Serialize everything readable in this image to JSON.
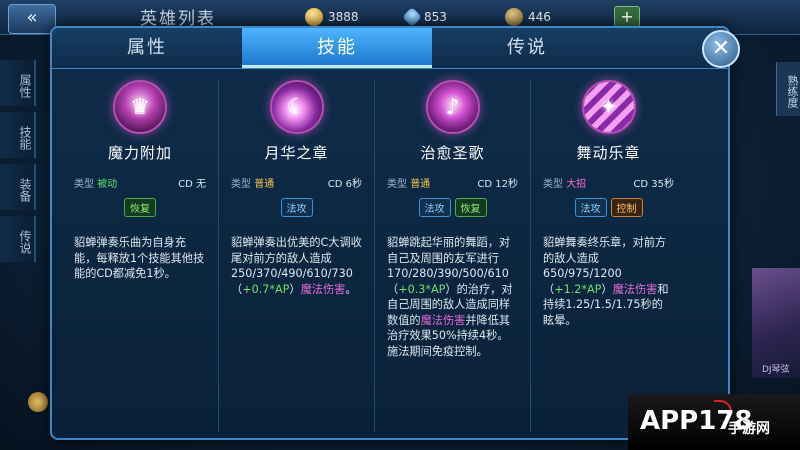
{
  "header": {
    "back_icon": "back-arrow-icon",
    "title": "英雄列表",
    "gold": "3888",
    "diamonds": "853",
    "coupons": "446",
    "plus_label": "+"
  },
  "side_tabs": [
    "属性",
    "技能",
    "装备",
    "传说"
  ],
  "right_tab": "熟练度",
  "right_art_label": "DJ琴弦",
  "dialog": {
    "tabs": [
      {
        "label": "属性",
        "active": false
      },
      {
        "label": "技能",
        "active": true
      },
      {
        "label": "传说",
        "active": false
      }
    ],
    "close_label": "✕"
  },
  "skills": [
    {
      "icon": "magic-boost-icon",
      "name": "魔力附加",
      "type_label": "类型",
      "type": "被动",
      "type_color": "#5fe070",
      "cd": "CD 无",
      "tags": [
        "恢复"
      ],
      "desc": {
        "p1": "貂蝉弹奏乐曲为自身充能，每释放1个技能其他技能的CD都减免1秒。"
      }
    },
    {
      "icon": "moon-chapter-icon",
      "name": "月华之章",
      "type_label": "类型",
      "type": "普通",
      "type_color": "#f2c74a",
      "cd": "CD 6秒",
      "tags": [
        "法攻"
      ],
      "desc": {
        "p1": "貂蝉弹奏出优美的C大调收尾对前方的敌人造成250/370/490/610/730（",
        "ap": "+0.7*AP",
        "p2": "）",
        "magic": "魔法伤害",
        "p3": "。"
      }
    },
    {
      "icon": "healing-song-icon",
      "name": "治愈圣歌",
      "type_label": "类型",
      "type": "普通",
      "type_color": "#f2c74a",
      "cd": "CD 12秒",
      "tags": [
        "法攻",
        "恢复"
      ],
      "desc": {
        "p1": "貂蝉跳起华丽的舞蹈，对自己及周围的友军进行170/280/390/500/610（",
        "ap": "+0.3*AP",
        "p2": "）的治疗，对自己周围的敌人造成同样数值的",
        "magic": "魔法伤害",
        "p3": "并降低其治疗效果50%持续4秒。施法期间免疫控制。"
      }
    },
    {
      "icon": "dance-chapter-icon",
      "name": "舞动乐章",
      "type_label": "类型",
      "type": "大招",
      "type_color": "#ff6fd8",
      "cd": "CD 35秒",
      "tags": [
        "法攻",
        "控制"
      ],
      "desc": {
        "p1": "貂蝉舞奏终乐章，对前方的敌人造成650/975/1200（",
        "ap": "+1.2*AP",
        "p2": "）",
        "magic": "魔法伤害",
        "p3": "和持续1.25/1.5/1.75秒的眩晕。"
      }
    }
  ],
  "watermark": {
    "logo": "APP178",
    "sub": "手游网"
  }
}
